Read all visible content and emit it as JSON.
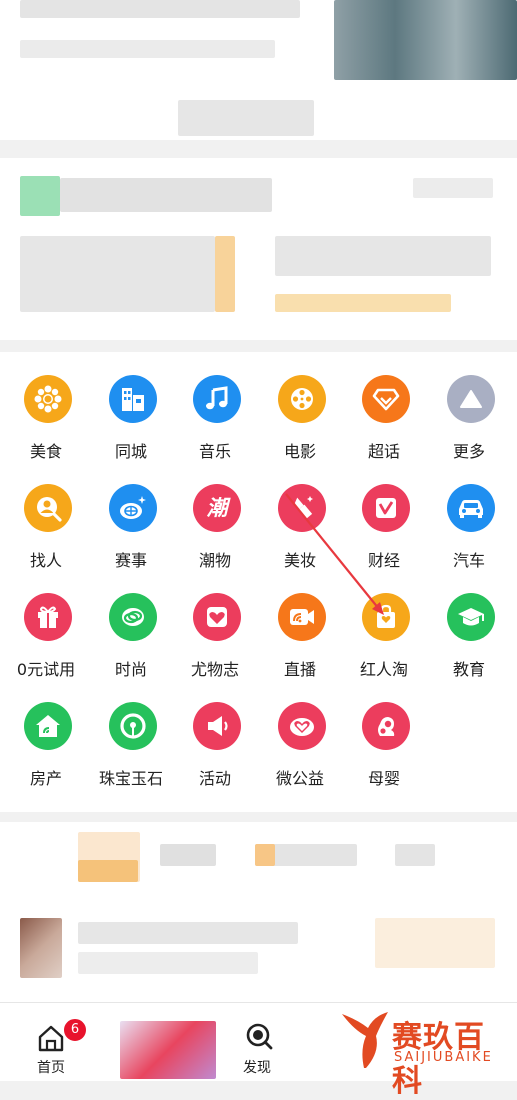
{
  "colors": {
    "accent_orange": "#f5a320",
    "accent_blue": "#1e8ef0",
    "accent_red": "#ec3d5d",
    "accent_green": "#26c15c",
    "gray_more": "#a9afc3",
    "arrow_red": "#e8393f"
  },
  "grid": {
    "items": [
      {
        "label": "美食",
        "icon": "sunflower-icon",
        "color": "#f6a71a"
      },
      {
        "label": "同城",
        "icon": "building-icon",
        "color": "#1f8ff0"
      },
      {
        "label": "音乐",
        "icon": "music-note-icon",
        "color": "#1f8ff0"
      },
      {
        "label": "电影",
        "icon": "film-reel-icon",
        "color": "#f6a71a"
      },
      {
        "label": "超话",
        "icon": "diamond-icon",
        "color": "#f6771a"
      },
      {
        "label": "更多",
        "icon": "triangle-up-icon",
        "color": "#a9afc3"
      },
      {
        "label": "找人",
        "icon": "person-search-icon",
        "color": "#f6a71a"
      },
      {
        "label": "赛事",
        "icon": "basketball-icon",
        "color": "#1f8ff0"
      },
      {
        "label": "潮物",
        "icon": "chao-text-icon",
        "color": "#ec3d5d"
      },
      {
        "label": "美妆",
        "icon": "lipstick-icon",
        "color": "#ec3d5d"
      },
      {
        "label": "财经",
        "icon": "finance-chart-icon",
        "color": "#ec3d5d"
      },
      {
        "label": "汽车",
        "icon": "car-icon",
        "color": "#1f8ff0"
      },
      {
        "label": "0元试用",
        "icon": "gift-icon",
        "color": "#ec3d5d"
      },
      {
        "label": "时尚",
        "icon": "ring-icon",
        "color": "#26c15c"
      },
      {
        "label": "尤物志",
        "icon": "heart-card-icon",
        "color": "#ec3d5d"
      },
      {
        "label": "直播",
        "icon": "live-camera-icon",
        "color": "#f6771a"
      },
      {
        "label": "红人淘",
        "icon": "shopping-bag-icon",
        "color": "#f6a71a"
      },
      {
        "label": "教育",
        "icon": "graduation-cap-icon",
        "color": "#26c15c"
      },
      {
        "label": "房产",
        "icon": "house-icon",
        "color": "#26c15c"
      },
      {
        "label": "珠宝玉石",
        "icon": "jade-pendant-icon",
        "color": "#26c15c"
      },
      {
        "label": "活动",
        "icon": "megaphone-icon",
        "color": "#ec3d5d"
      },
      {
        "label": "微公益",
        "icon": "charity-heart-icon",
        "color": "#ec3d5d"
      },
      {
        "label": "母婴",
        "icon": "mother-baby-icon",
        "color": "#ec3d5d"
      }
    ]
  },
  "tabbar": {
    "home_label": "首页",
    "home_badge": "6",
    "discover_label": "发现"
  },
  "watermark": {
    "name": "赛玖百科",
    "sub": "SAIJIUBAIKE"
  }
}
